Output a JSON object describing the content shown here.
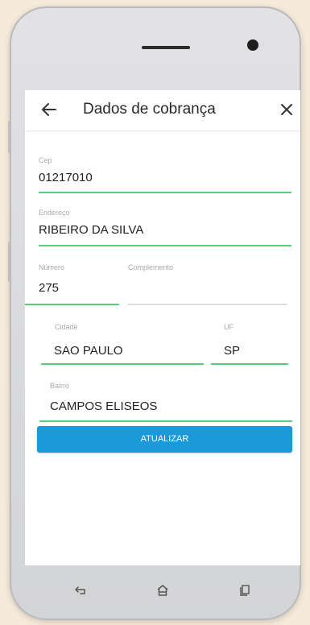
{
  "header": {
    "title": "Dados de cobrança"
  },
  "form": {
    "cep": {
      "label": "Cep",
      "value": "01217010"
    },
    "endereco": {
      "label": "Endereço",
      "value": "RIBEIRO DA SILVA"
    },
    "numero": {
      "label": "Número",
      "value": "275"
    },
    "complemento": {
      "label": "Complemento",
      "value": ""
    },
    "cidade": {
      "label": "Cidade",
      "value": "SAO PAULO"
    },
    "uf": {
      "label": "UF",
      "value": "SP"
    },
    "bairro": {
      "label": "Bairro",
      "value": "CAMPOS ELISEOS"
    }
  },
  "actions": {
    "update_label": "ATUALIZAR"
  },
  "colors": {
    "accent_green": "#56cd7d",
    "inactive_line": "#dcdcdc",
    "button_blue": "#1a9ad9"
  },
  "icons": {
    "back": "arrow-left-icon",
    "close": "close-icon",
    "nav_back": "nav-back-icon",
    "nav_home": "nav-home-icon",
    "nav_recents": "nav-recents-icon"
  }
}
